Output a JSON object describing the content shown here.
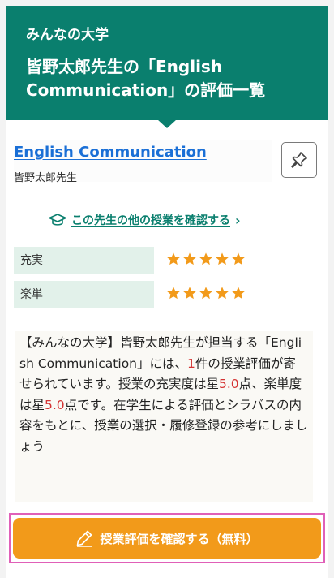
{
  "header": {
    "site_name": "みんなの大学",
    "title": "皆野太郎先生の「English Communication」の評価一覧"
  },
  "subject": {
    "name": "English Communication",
    "teacher": "皆野太郎先生"
  },
  "pin_icon": "pin-icon",
  "other_classes_link": {
    "icon": "graduation-cap-icon",
    "label": "この先生の他の授業を確認する",
    "chevron": "›"
  },
  "ratings": [
    {
      "label": "充実",
      "stars": 5,
      "max": 5
    },
    {
      "label": "楽単",
      "stars": 5,
      "max": 5
    }
  ],
  "description": {
    "p1": "【みんなの大学】皆野太郎先生が担当する「English Communication」には、",
    "count": "1",
    "p2": "件の授業評価が寄せられています。授業の充実度は星",
    "fulfillment": "5.0",
    "p3": "点、楽単度は星",
    "easiness": "5.0",
    "p4": "点です。在学生による評価とシラバスの内容をもとに、授業の選択・履修登録の参考にしましょう"
  },
  "cta": {
    "label": "授業評価を確認する（無料）",
    "icon": "pencil-icon"
  },
  "colors": {
    "primary": "#0a7f6e",
    "link": "#1a6fd6",
    "star": "#f29a1a",
    "cta": "#f29a1a",
    "highlight": "#d43333"
  }
}
